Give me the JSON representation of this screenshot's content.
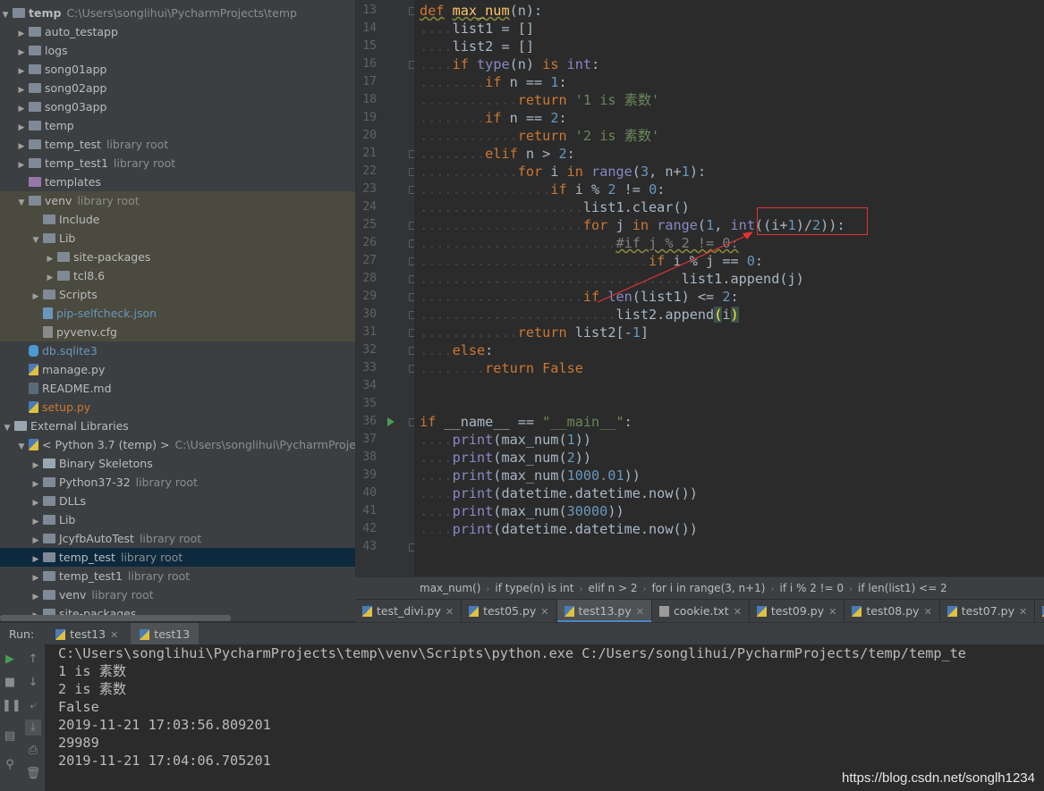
{
  "tree": {
    "root": {
      "name": "temp",
      "path": "C:\\Users\\songlihui\\PycharmProjects\\temp"
    },
    "items": [
      {
        "label": "auto_testapp",
        "tag": ""
      },
      {
        "label": "logs",
        "tag": ""
      },
      {
        "label": "song01app",
        "tag": ""
      },
      {
        "label": "song02app",
        "tag": ""
      },
      {
        "label": "song03app",
        "tag": ""
      },
      {
        "label": "temp",
        "tag": ""
      },
      {
        "label": "temp_test",
        "tag": "library root"
      },
      {
        "label": "temp_test1",
        "tag": "library root"
      },
      {
        "label": "templates",
        "tag": ""
      },
      {
        "label": "venv",
        "tag": "library root"
      },
      {
        "label": "Include",
        "tag": ""
      },
      {
        "label": "Lib",
        "tag": ""
      },
      {
        "label": "site-packages",
        "tag": ""
      },
      {
        "label": "tcl8.6",
        "tag": ""
      },
      {
        "label": "Scripts",
        "tag": ""
      },
      {
        "label": "pip-selfcheck.json",
        "tag": ""
      },
      {
        "label": "pyvenv.cfg",
        "tag": ""
      },
      {
        "label": "db.sqlite3",
        "tag": ""
      },
      {
        "label": "manage.py",
        "tag": ""
      },
      {
        "label": "README.md",
        "tag": ""
      },
      {
        "label": "setup.py",
        "tag": ""
      },
      {
        "label": "External Libraries",
        "tag": ""
      },
      {
        "label": "< Python 3.7 (temp) >",
        "tag": "C:\\Users\\songlihui\\PycharmProjects\\"
      },
      {
        "label": "Binary Skeletons",
        "tag": ""
      },
      {
        "label": "Python37-32",
        "tag": "library root"
      },
      {
        "label": "DLLs",
        "tag": ""
      },
      {
        "label": "Lib",
        "tag": ""
      },
      {
        "label": "JcyfbAutoTest",
        "tag": "library root"
      },
      {
        "label": "temp_test",
        "tag": "library root"
      },
      {
        "label": "temp_test1",
        "tag": "library root"
      },
      {
        "label": "venv",
        "tag": "library root"
      },
      {
        "label": "site-packages",
        "tag": ""
      }
    ]
  },
  "editor": {
    "line_numbers": [
      "13",
      "14",
      "15",
      "16",
      "17",
      "18",
      "19",
      "20",
      "21",
      "22",
      "23",
      "24",
      "25",
      "26",
      "27",
      "28",
      "29",
      "30",
      "31",
      "32",
      "33",
      "34",
      "35",
      "36",
      "37",
      "38",
      "39",
      "40",
      "41",
      "42",
      "43"
    ]
  },
  "breadcrumb": [
    "max_num()",
    "if type(n) is int",
    "elif n > 2",
    "for i in range(3, n+1)",
    "if i % 2 != 0",
    "if len(list1) <= 2"
  ],
  "tabs": [
    "test_divi.py",
    "test05.py",
    "test13.py",
    "cookie.txt",
    "test09.py",
    "test08.py",
    "test07.py",
    "tes"
  ],
  "run": {
    "label": "Run:",
    "tabs": [
      "test13",
      "test13"
    ],
    "output": [
      "C:\\Users\\songlihui\\PycharmProjects\\temp\\venv\\Scripts\\python.exe C:/Users/songlihui/PycharmProjects/temp/temp_te",
      "1 is 素数",
      "2 is 素数",
      "False",
      "2019-11-21 17:03:56.809201",
      "29989",
      "2019-11-21 17:04:06.705201"
    ]
  },
  "watermark": "https://blog.csdn.net/songlh1234",
  "colors": {
    "keyword": "#cc7832",
    "function": "#ffc66d",
    "number": "#6897bb",
    "string": "#6a8759",
    "annotation": "#e53333"
  }
}
